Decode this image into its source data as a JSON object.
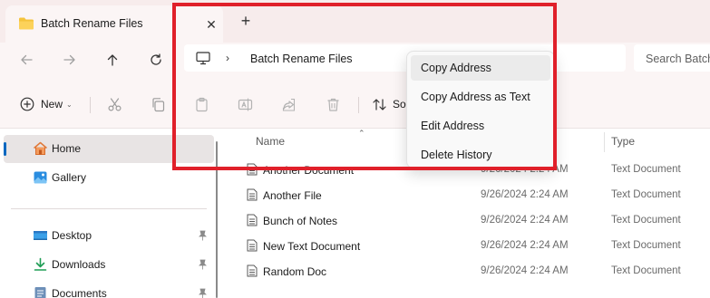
{
  "tab": {
    "title": "Batch Rename Files",
    "close_glyph": "✕",
    "new_tab_glyph": "+"
  },
  "address": {
    "breadcrumb": "Batch Rename Files",
    "chevron": "›"
  },
  "search": {
    "placeholder": "Search Batch Rename Files"
  },
  "toolbar": {
    "new_label": "New",
    "new_caret": "⌄",
    "sort_label": "Sort"
  },
  "sidebar": {
    "items": [
      {
        "label": "Home",
        "icon": "home-icon"
      },
      {
        "label": "Gallery",
        "icon": "gallery-icon"
      },
      {
        "label": "Desktop",
        "icon": "desktop-icon"
      },
      {
        "label": "Downloads",
        "icon": "downloads-icon"
      },
      {
        "label": "Documents",
        "icon": "documents-icon"
      }
    ]
  },
  "columns": {
    "name": "Name",
    "type": "Type"
  },
  "files": [
    {
      "name": "Another Document",
      "date": "9/26/2024 2:24 AM",
      "type": "Text Document"
    },
    {
      "name": "Another File",
      "date": "9/26/2024 2:24 AM",
      "type": "Text Document"
    },
    {
      "name": "Bunch of Notes",
      "date": "9/26/2024 2:24 AM",
      "type": "Text Document"
    },
    {
      "name": "New Text Document",
      "date": "9/26/2024 2:24 AM",
      "type": "Text Document"
    },
    {
      "name": "Random Doc",
      "date": "9/26/2024 2:24 AM",
      "type": "Text Document"
    }
  ],
  "context_menu": {
    "items": [
      "Copy Address",
      "Copy Address as Text",
      "Edit Address",
      "Delete History"
    ]
  },
  "colors": {
    "highlight": "#e0202a",
    "accent": "#0067c0",
    "folder": "#f5c33b"
  }
}
